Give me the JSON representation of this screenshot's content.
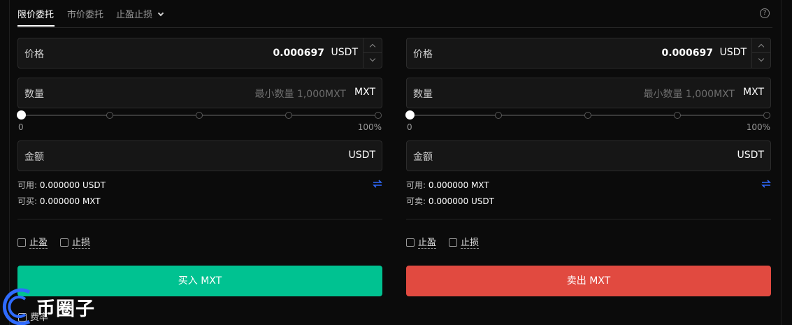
{
  "tabs": [
    {
      "label": "限价委托",
      "active": true
    },
    {
      "label": "市价委托",
      "active": false
    },
    {
      "label": "止盈止损",
      "active": false
    }
  ],
  "help_icon": "question-circle-icon",
  "buy": {
    "price_label": "价格",
    "price_value": "0.000697",
    "price_unit": "USDT",
    "qty_label": "数量",
    "qty_placeholder": "最小数量 1,000MXT",
    "qty_unit": "MXT",
    "slider_min": "0",
    "slider_max": "100%",
    "slider_value": 0,
    "amount_label": "金额",
    "amount_unit": "USDT",
    "available_label": "可用:",
    "available_value": "0.000000 USDT",
    "can_label": "可买:",
    "can_value": "0.000000 MXT",
    "take_profit": "止盈",
    "stop_loss": "止损",
    "button": "买入 MXT"
  },
  "sell": {
    "price_label": "价格",
    "price_value": "0.000697",
    "price_unit": "USDT",
    "qty_label": "数量",
    "qty_placeholder": "最小数量 1,000MXT",
    "qty_unit": "MXT",
    "slider_min": "0",
    "slider_max": "100%",
    "slider_value": 0,
    "amount_label": "金额",
    "amount_unit": "USDT",
    "available_label": "可用:",
    "available_value": "0.000000 MXT",
    "can_label": "可卖:",
    "can_value": "0.000000 USDT",
    "take_profit": "止盈",
    "stop_loss": "止损",
    "button": "卖出 MXT"
  },
  "fee_label": "费率",
  "watermark_text": "币圈子",
  "colors": {
    "buy": "#00c291",
    "sell": "#e14a40",
    "accent": "#2f6bff"
  }
}
